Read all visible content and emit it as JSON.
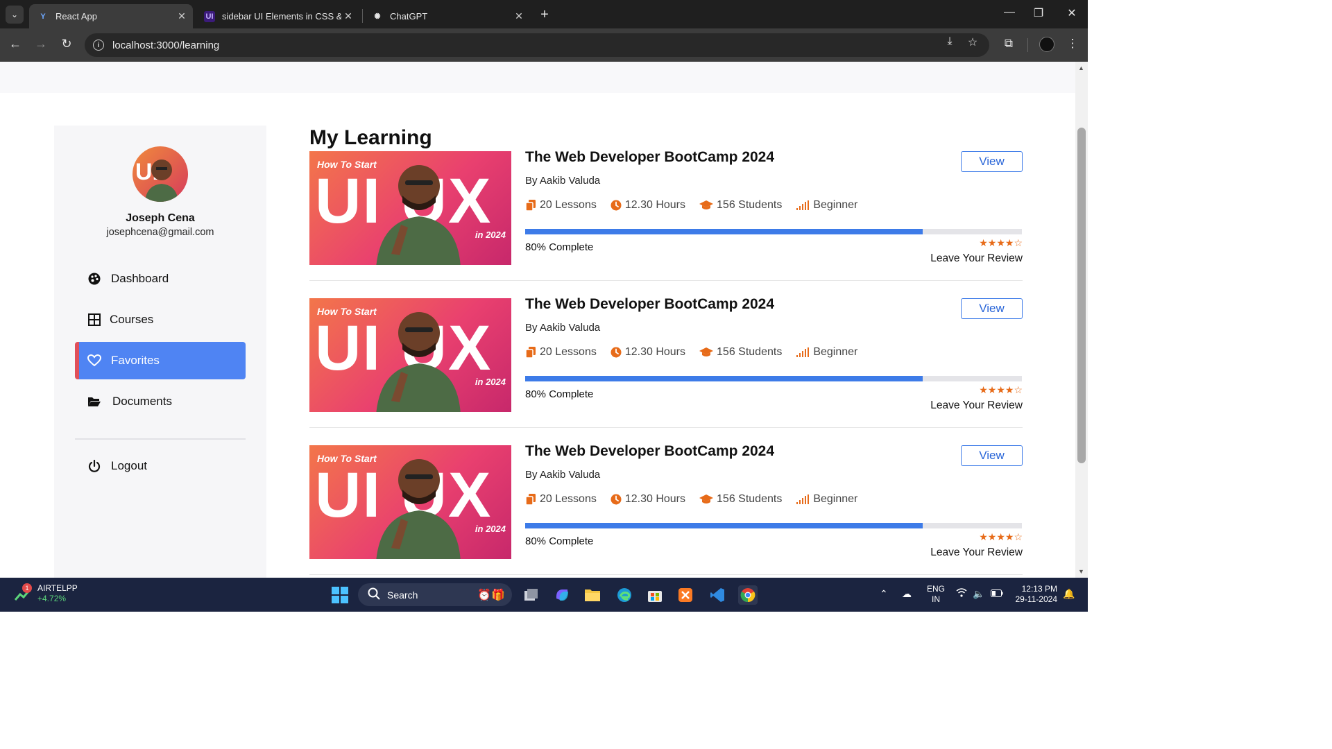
{
  "browser": {
    "tabs": [
      {
        "title": "React App",
        "icon": "react-icon",
        "active": true
      },
      {
        "title": "sidebar UI Elements in CSS & Ta",
        "icon": "uiverse-icon",
        "active": false
      },
      {
        "title": "ChatGPT",
        "icon": "chatgpt-icon",
        "active": false
      }
    ],
    "url": "localhost:3000/learning"
  },
  "sidebar": {
    "user_name": "Joseph Cena",
    "user_email": "josephcena@gmail.com",
    "items": [
      {
        "label": "Dashboard",
        "icon": "palette-icon",
        "active": false
      },
      {
        "label": "Courses",
        "icon": "grid-icon",
        "active": false
      },
      {
        "label": "Favorites",
        "icon": "heart-icon",
        "active": true
      },
      {
        "label": "Documents",
        "icon": "folder-open-icon",
        "active": false
      }
    ],
    "logout_label": "Logout"
  },
  "main": {
    "title": "My Learning",
    "courses": [
      {
        "title": "The Web Developer BootCamp 2024",
        "author": "By Aakib Valuda",
        "lessons": "20 Lessons",
        "hours": "12.30 Hours",
        "students": "156 Students",
        "level": "Beginner",
        "progress": 0.8,
        "progress_label": "80% Complete",
        "rating": 4,
        "view_label": "View",
        "review_label": "Leave Your Review",
        "thumb": {
          "howto": "How To Start",
          "big": "UI UX",
          "year": "in 2024"
        }
      },
      {
        "title": "The Web Developer BootCamp 2024",
        "author": "By Aakib Valuda",
        "lessons": "20 Lessons",
        "hours": "12.30 Hours",
        "students": "156 Students",
        "level": "Beginner",
        "progress": 0.8,
        "progress_label": "80% Complete",
        "rating": 4,
        "view_label": "View",
        "review_label": "Leave Your Review",
        "thumb": {
          "howto": "How To Start",
          "big": "UI UX",
          "year": "in 2024"
        }
      },
      {
        "title": "The Web Developer BootCamp 2024",
        "author": "By Aakib Valuda",
        "lessons": "20 Lessons",
        "hours": "12.30 Hours",
        "students": "156 Students",
        "level": "Beginner",
        "progress": 0.8,
        "progress_label": "80% Complete",
        "rating": 4,
        "view_label": "View",
        "review_label": "Leave Your Review",
        "thumb": {
          "howto": "How To Start",
          "big": "UI UX",
          "year": "in 2024"
        }
      }
    ]
  },
  "taskbar": {
    "stock_name": "AIRTELPP",
    "stock_change": "+4.72%",
    "stock_badge": "1",
    "search_label": "Search",
    "lang_line1": "ENG",
    "lang_line2": "IN",
    "time": "12:13 PM",
    "date": "29-11-2024"
  },
  "colors": {
    "accent": "#4f84f3",
    "active_border": "#e0505a",
    "progress": "#3d7be8",
    "meta_icon": "#e76b19"
  }
}
